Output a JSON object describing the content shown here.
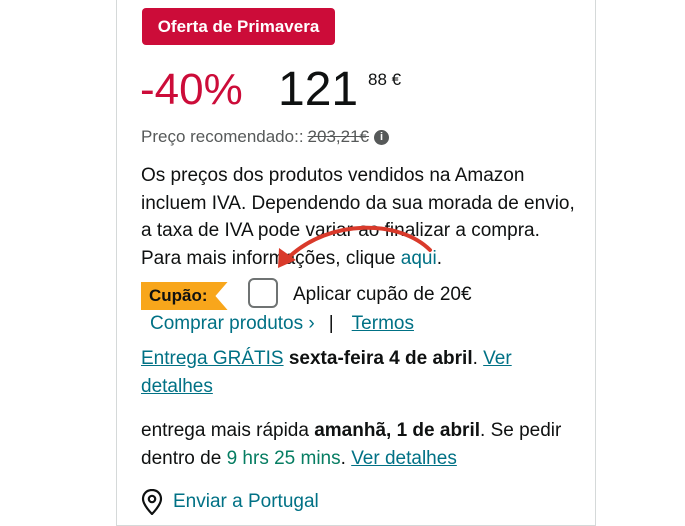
{
  "deal": {
    "badge": "Oferta de Primavera"
  },
  "price": {
    "discount": "-40%",
    "whole": "121",
    "fraction": "88 €",
    "recommended_label": "Preço recomendado::",
    "recommended_value": "203,21€",
    "info_icon": "info-circle-icon"
  },
  "vat_note": {
    "text": "Os preços dos produtos vendidos na Amazon incluem IVA. Dependendo da sua morada de envio, a taxa de IVA pode variar ao finalizar a compra. Para mais informações, clique",
    "link": "aqui",
    "end": "."
  },
  "coupon": {
    "tag": "Cupão:",
    "label": "Aplicar cupão de 20€",
    "shop_link": "Comprar produtos ›",
    "separator": "|",
    "terms_link": "Termos"
  },
  "delivery": {
    "free_link": "Entrega GRÁTIS",
    "date": "sexta-feira 4 de abril",
    "period": ".",
    "details_link": "Ver detalhes",
    "fast_prefix": "entrega mais rápida",
    "fast_date": "amanhã, 1 de abril",
    "fast_mid": ". Se pedir dentro de",
    "countdown": "9 hrs 25 mins",
    "details_link2": "Ver detalhes"
  },
  "ship_to": {
    "icon": "location-pin-icon",
    "label": "Enviar a Portugal"
  },
  "colors": {
    "deal_red": "#cc0c39",
    "link": "#007185",
    "coupon_tag": "#f8a61b",
    "green": "#067d62",
    "annotation_arrow": "#d93a2b"
  }
}
